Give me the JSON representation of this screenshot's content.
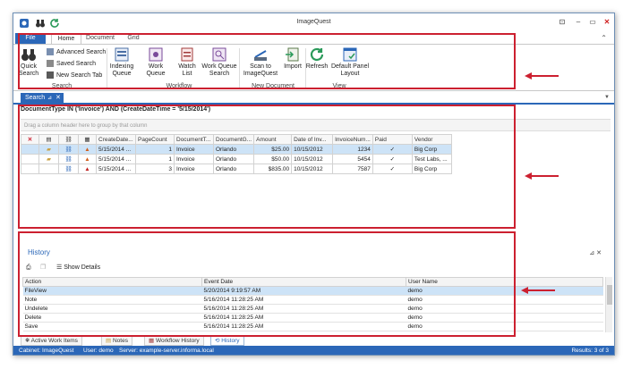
{
  "window": {
    "title": "ImageQuest"
  },
  "ribbon_tabs": [
    "File",
    "Home",
    "Document",
    "Grid"
  ],
  "ribbon": {
    "search_group": {
      "quick_search": "Quick Search",
      "advanced_search": "Advanced Search",
      "saved_search": "Saved Search",
      "new_search_tab": "New Search Tab",
      "label": "Search"
    },
    "workflow_group": {
      "indexing_queue": "Indexing Queue",
      "work_queue": "Work Queue",
      "watch_list": "Watch List",
      "work_queue_search": "Work Queue Search",
      "label": "Workflow"
    },
    "new_document_group": {
      "scan": "Scan to ImageQuest",
      "import": "Import",
      "label": "New Document"
    },
    "view_group": {
      "refresh": "Refresh",
      "default_layout": "Default Panel Layout",
      "label": "View"
    }
  },
  "doc_tab": {
    "label": "Search",
    "pin": "⊿",
    "close": "✕"
  },
  "search": {
    "filter": "DocumentType IN ('Invoice') AND (CreateDateTime = '5/15/2014')",
    "group_hint": "Drag a column header here to group by that column",
    "columns": [
      "CreateDate...",
      "PageCount",
      "DocumentT...",
      "DocumentG...",
      "Amount",
      "Date of Inv...",
      "InvoiceNum...",
      "Paid",
      "Vendor"
    ],
    "rows": [
      {
        "create": "5/15/2014 ...",
        "pages": "1",
        "type": "Invoice",
        "group": "Orlando",
        "amount": "$25.00",
        "date": "10/15/2012",
        "num": "1234",
        "paid": "✓",
        "vendor": "Big Corp"
      },
      {
        "create": "5/15/2014 ...",
        "pages": "1",
        "type": "Invoice",
        "group": "Orlando",
        "amount": "$50.00",
        "date": "10/15/2012",
        "num": "5454",
        "paid": "✓",
        "vendor": "Test Labs, ..."
      },
      {
        "create": "5/15/2014 ...",
        "pages": "3",
        "type": "Invoice",
        "group": "Orlando",
        "amount": "$835.00",
        "date": "10/15/2012",
        "num": "7587",
        "paid": "✓",
        "vendor": "Big Corp"
      }
    ]
  },
  "history": {
    "title": "History",
    "controls": "⊿  ✕",
    "show_details": "Show Details",
    "columns": [
      "Action",
      "Event Date",
      "User Name"
    ],
    "rows": [
      {
        "action": "FileView",
        "date": "5/20/2014 9:19:57 AM",
        "user": "demo"
      },
      {
        "action": "Note",
        "date": "5/16/2014 11:28:25 AM",
        "user": "demo"
      },
      {
        "action": "Undelete",
        "date": "5/16/2014 11:28:25 AM",
        "user": "demo"
      },
      {
        "action": "Delete",
        "date": "5/16/2014 11:28:25 AM",
        "user": "demo"
      },
      {
        "action": "Save",
        "date": "5/16/2014 11:28:25 AM",
        "user": "demo"
      }
    ]
  },
  "bottom_tabs": [
    "Active Work Items",
    "Notes",
    "Workflow History",
    "History"
  ],
  "status": {
    "cabinet": "Cabinet: ImageQuest",
    "user": "User: demo",
    "server": "Server: example-server.informa.local",
    "results": "Results: 3 of 3"
  },
  "colors": {
    "accent": "#2b67b8",
    "highlight": "#cc2030",
    "selection": "#cde3f7"
  }
}
